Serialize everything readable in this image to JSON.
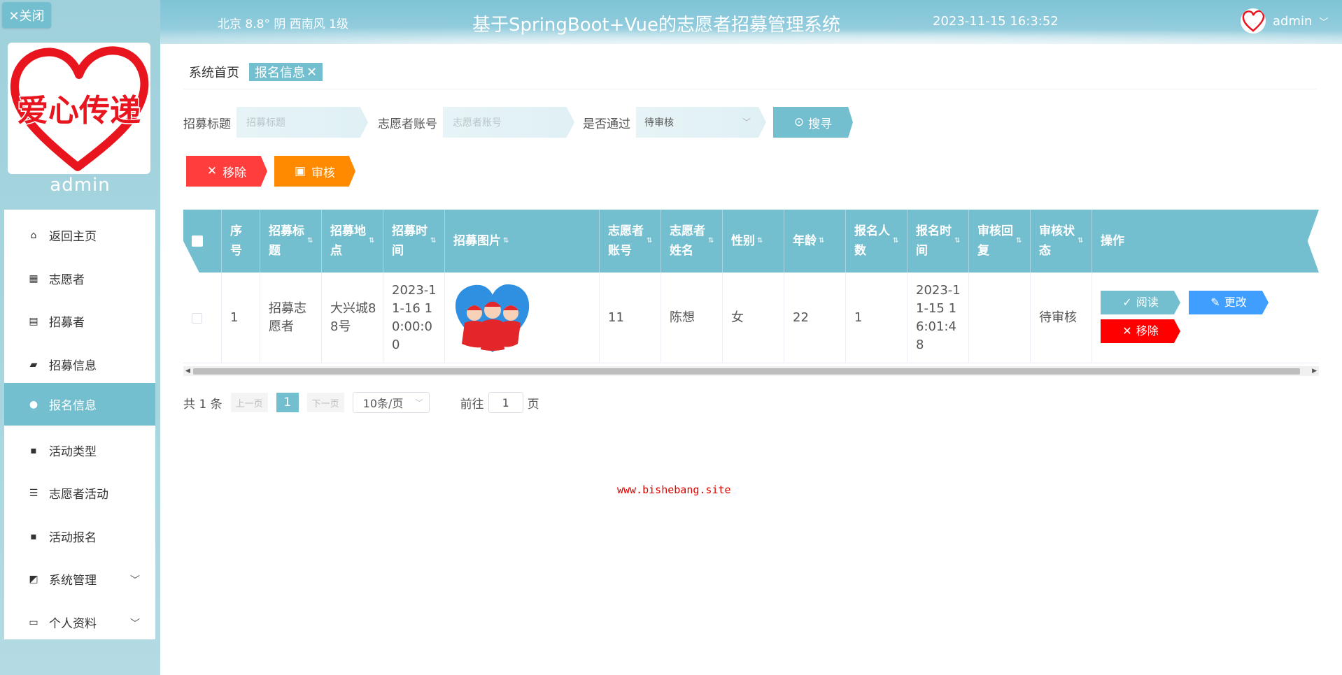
{
  "sidebar": {
    "close_label": "✕关闭",
    "logo_text": "爱心传递",
    "admin_name": "admin",
    "menu": [
      {
        "label": "返回主页",
        "icon": "home-icon"
      },
      {
        "label": "志愿者",
        "icon": "grid-icon"
      },
      {
        "label": "招募者",
        "icon": "clipboard-icon"
      },
      {
        "label": "招募信息",
        "icon": "briefcase-icon"
      },
      {
        "label": "报名信息",
        "icon": "user-icon"
      },
      {
        "label": "活动类型",
        "icon": "apps-icon"
      },
      {
        "label": "志愿者活动",
        "icon": "sliders-icon"
      },
      {
        "label": "活动报名",
        "icon": "apps-icon"
      },
      {
        "label": "系统管理",
        "icon": "chart-icon"
      },
      {
        "label": "个人资料",
        "icon": "card-icon"
      }
    ],
    "active_index": 4
  },
  "header": {
    "weather": "北京  8.8°  阴  西南风  1级",
    "title": "基于SpringBoot+Vue的志愿者招募管理系统",
    "datetime": "2023-11-15 16:3:52",
    "user": "admin"
  },
  "breadcrumb": {
    "home": "系统首页",
    "current": "报名信息"
  },
  "search": {
    "title_label": "招募标题",
    "title_placeholder": "招募标题",
    "account_label": "志愿者账号",
    "account_placeholder": "志愿者账号",
    "pass_label": "是否通过",
    "pass_value": "待审核",
    "search_button": "搜寻"
  },
  "actions": {
    "remove": "移除",
    "audit": "审核"
  },
  "table": {
    "columns": [
      "序号",
      "招募标题",
      "招募地点",
      "招募时间",
      "招募图片",
      "志愿者账号",
      "志愿者姓名",
      "性别",
      "年龄",
      "报名人数",
      "报名时间",
      "审核回复",
      "审核状态",
      "操作"
    ],
    "rows": [
      {
        "index": "1",
        "title": "招募志愿者",
        "location": "大兴城88号",
        "recruit_time": "2023-11-16 10:00:00",
        "account": "11",
        "name": "陈想",
        "gender": "女",
        "age": "22",
        "count": "1",
        "signup_time": "2023-11-15 16:01:48",
        "reply": "",
        "status": "待审核",
        "btn_read": "阅读",
        "btn_edit": "更改",
        "btn_remove": "移除"
      }
    ]
  },
  "watermark": "www.bishebang.site",
  "pager": {
    "total": "共 1 条",
    "prev": "上一页",
    "current": "1",
    "next": "下一页",
    "size": "10条/页",
    "goto_label": "前往",
    "goto_value": "1",
    "page_suffix": "页"
  },
  "colors": {
    "accent": "#74bfcf",
    "danger": "#ff3d3d",
    "warning": "#ff8a00",
    "primary": "#409eff"
  }
}
